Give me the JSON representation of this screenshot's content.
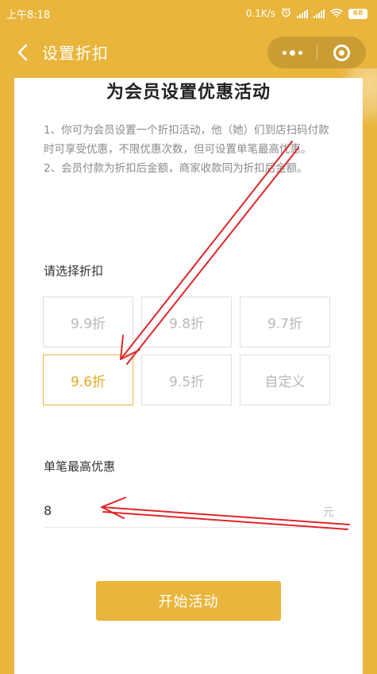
{
  "status_bar": {
    "time": "上午8:18",
    "speed": "0.1K/s",
    "battery": "68",
    "icons": [
      "alarm-icon",
      "signal-icon",
      "signal-icon",
      "wifi-icon",
      "battery-icon"
    ]
  },
  "nav": {
    "back_icon": "chevron-left-icon",
    "title": "设置折扣",
    "more_icon": "more-dots-icon",
    "close_icon": "mini-program-close-icon"
  },
  "page": {
    "headline": "为会员设置优惠活动",
    "notes": [
      "1、你可为会员设置一个折扣活动，他（她）们到店扫码付款时可享受优惠，不限优惠次数，但可设置单笔最高优惠。",
      "2、会员付款为折扣后金额，商家收款同为折扣后金额。"
    ],
    "discount_label": "请选择折扣",
    "discount_options": [
      "9.9折",
      "9.8折",
      "9.7折",
      "9.6折",
      "9.5折",
      "自定义"
    ],
    "selected_option": "9.6折",
    "max_label": "单笔最高优惠",
    "max_value": "8",
    "max_unit": "元",
    "start_button": "开始活动"
  },
  "colors": {
    "brand": "#e9b53c",
    "selected_text": "#e1a925",
    "annotation_arrow": "#e0262a"
  }
}
